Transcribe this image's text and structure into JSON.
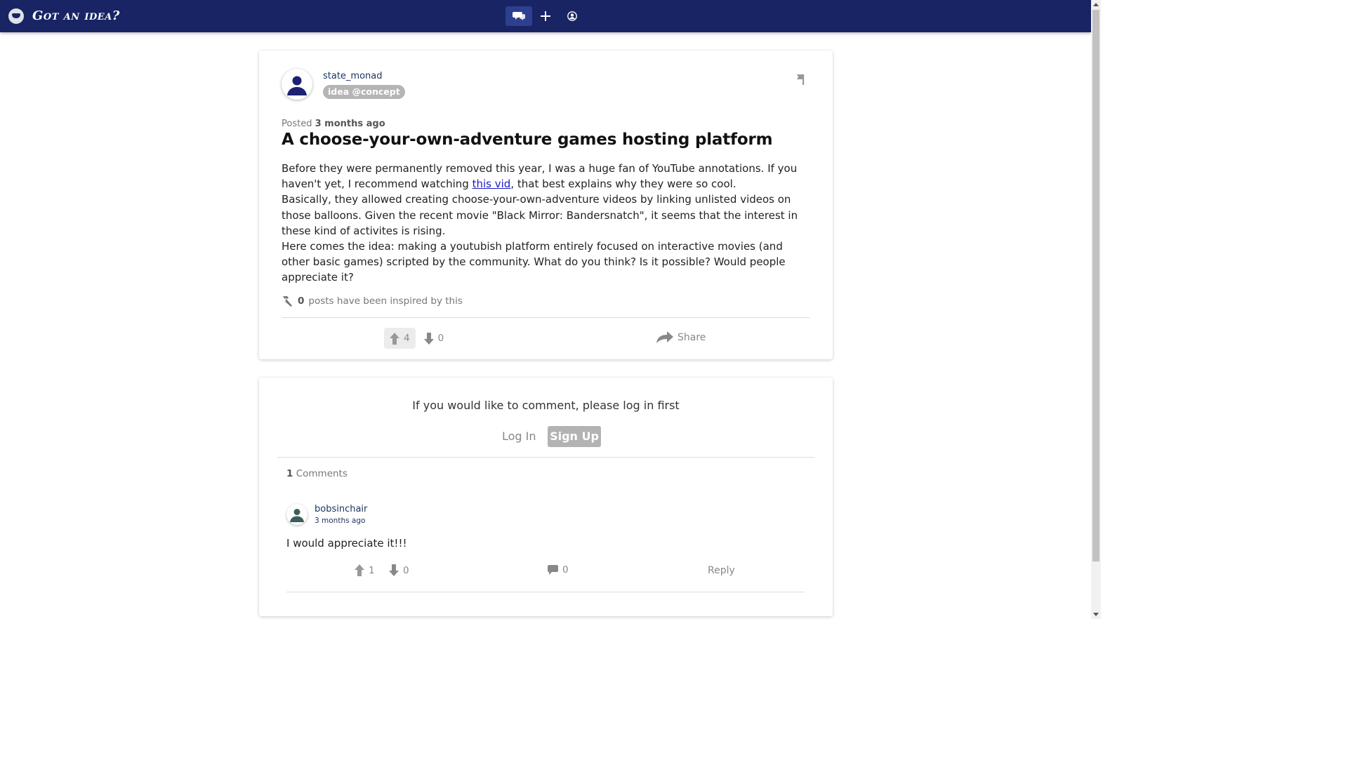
{
  "colors": {
    "navbar": "#182464",
    "accent": "#1a1ac8",
    "muted": "#888888"
  },
  "navbar": {
    "title": "Got an idea?",
    "logo_icon": "bulb-icon",
    "buttons": [
      {
        "icon": "chat-bubbles-icon",
        "active": true
      },
      {
        "icon": "plus-icon",
        "active": false
      },
      {
        "icon": "user-circle-icon",
        "active": false
      }
    ]
  },
  "post": {
    "author": "state_monad",
    "tag": "idea @concept",
    "posted_prefix": "Posted",
    "posted_time": "3 months ago",
    "title": "A choose-your-own-adventure games hosting platform",
    "body_p1_before": "Before they were permanently removed this year, I was a huge fan of YouTube annotations. If you haven't yet, I recommend watching ",
    "body_link": "this vid",
    "body_p1_after": ", that best explains why they were so cool.",
    "body_p2": "Basically, they allowed creating choose-your-own-adventure videos by linking unlisted videos on those balloons. Given the recent movie \"Black Mirror: Bandersnatch\", it seems that the interest in these kind of activites is rising.",
    "body_p3": "Here comes the idea: making a youtubish platform entirely focused on interactive movies (and other basic games) scripted by the community. What do you think? Is it possible? Would people appreciate it?",
    "inspired_count": "0",
    "inspired_text": "posts have been inspired by this",
    "upvotes": "4",
    "downvotes": "0",
    "share_label": "Share"
  },
  "comments_section": {
    "login_prompt": "If you would like to comment, please log in first",
    "login_label": "Log In",
    "signup_label": "Sign Up",
    "count": "1",
    "count_label": "Comments",
    "comments": [
      {
        "author": "bobsinchair",
        "time": "3 months ago",
        "text": "I would appreciate it!!!",
        "upvotes": "1",
        "downvotes": "0",
        "replies": "0",
        "reply_label": "Reply"
      }
    ]
  }
}
